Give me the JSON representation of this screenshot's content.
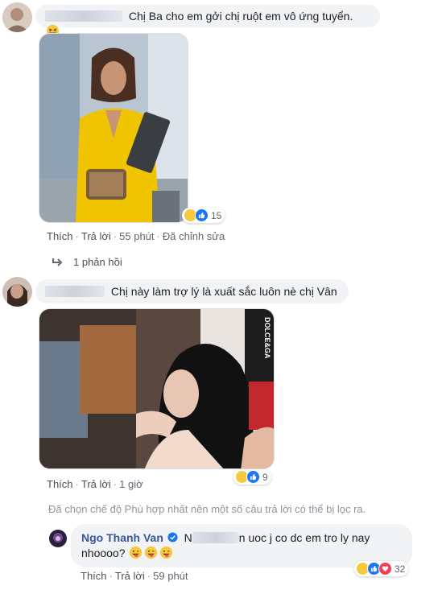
{
  "comments": [
    {
      "text": "Chị Ba cho em gởi chị ruột em vô ứng tuyển.",
      "emoji": "grinning-squint-emoji-icon",
      "actions": {
        "like": "Thích",
        "reply": "Trả lời",
        "time": "55 phút",
        "edited": "Đã chỉnh sửa"
      },
      "reaction_count": "15",
      "reply_summary": "1 phản hồi"
    },
    {
      "text": "Chị này làm trợ lý là xuất sắc luôn nè chị Vân",
      "actions": {
        "like": "Thích",
        "reply": "Trả lời",
        "time": "1 giờ"
      },
      "reaction_count": "9",
      "photo_caption": "DOLCE&GA"
    }
  ],
  "filter_notice": "Đã chọn chế độ Phù hợp nhất nên một số câu trả lời có thể bị lọc ra.",
  "reply": {
    "author": "Ngo Thanh Van",
    "text_start": "N",
    "text_line1_end": "n uoc j co dc em tro ly nay",
    "text_line2": "nhoooo?",
    "actions": {
      "like": "Thích",
      "reply": "Trả lời",
      "time": "59 phút"
    },
    "reaction_count": "32"
  },
  "colors": {
    "link": "#4b4f56",
    "verified": "#1877f2",
    "bubble": "#f2f3f5",
    "like": "#1877f2",
    "haha": "#f7c93e",
    "love": "#f33e58"
  }
}
